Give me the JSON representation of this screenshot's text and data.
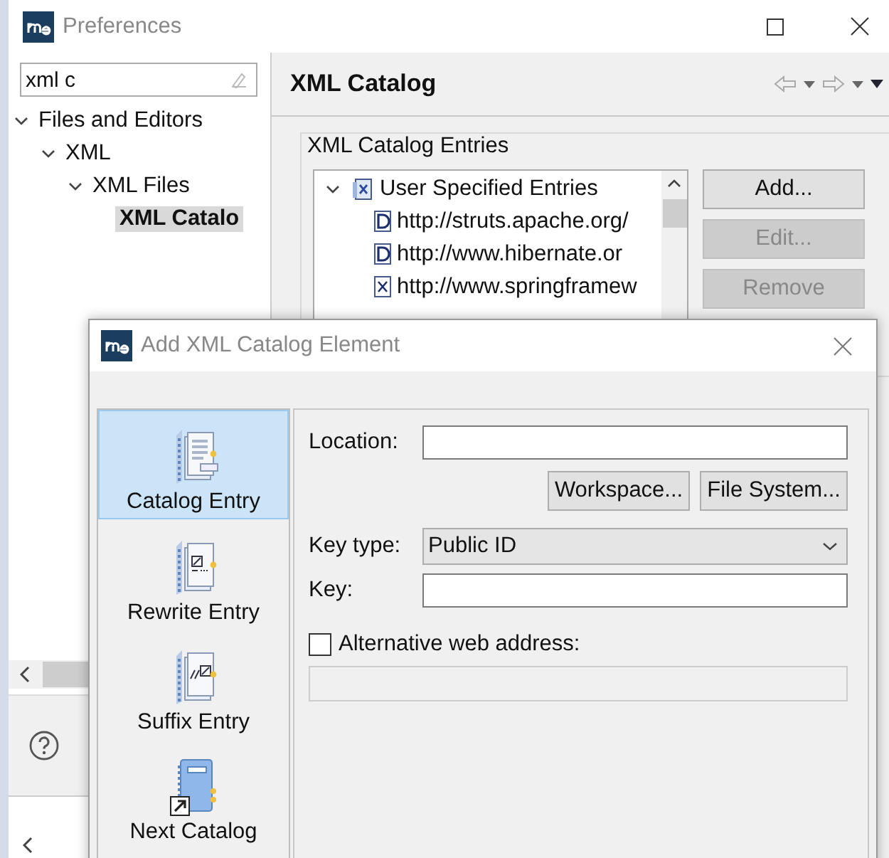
{
  "window": {
    "title": "Preferences"
  },
  "filter": {
    "value": "xml c"
  },
  "tree": [
    {
      "label": "Files and Editors",
      "expanded": true,
      "selected": false,
      "children": [
        {
          "label": "XML",
          "expanded": true,
          "selected": false,
          "children": [
            {
              "label": "XML Files",
              "expanded": true,
              "selected": false,
              "children": [
                {
                  "label": "XML Catalo",
                  "selected": true
                }
              ]
            }
          ]
        }
      ]
    }
  ],
  "page": {
    "title": "XML Catalog"
  },
  "group": {
    "title": "XML Catalog Entries"
  },
  "entries": [
    {
      "label": "User Specified Entries",
      "kind": "group",
      "expanded": true,
      "children": [
        {
          "label": "http://struts.apache.org/",
          "kind": "dtd"
        },
        {
          "label": "http://www.hibernate.or",
          "kind": "dtd"
        },
        {
          "label": "http://www.springframew",
          "kind": "xsd"
        }
      ]
    }
  ],
  "entry_buttons": [
    {
      "label": "Add...",
      "disabled": false
    },
    {
      "label": "Edit...",
      "disabled": true
    },
    {
      "label": "Remove",
      "disabled": true
    }
  ],
  "dialog": {
    "title": "Add XML Catalog Element",
    "types": [
      {
        "label": "Catalog Entry",
        "kind": "catalog",
        "selected": true
      },
      {
        "label": "Rewrite Entry",
        "kind": "rewrite",
        "selected": false
      },
      {
        "label": "Suffix Entry",
        "kind": "suffix",
        "selected": false
      },
      {
        "label": "Next Catalog",
        "kind": "next",
        "selected": false
      }
    ],
    "location": {
      "label": "Location:"
    },
    "browse_buttons": [
      "Workspace...",
      "File System..."
    ],
    "key_type": {
      "label": "Key type:",
      "value": "Public ID"
    },
    "key": {
      "label": "Key:"
    },
    "alternative": {
      "label": "Alternative web address:",
      "checked": false
    }
  }
}
